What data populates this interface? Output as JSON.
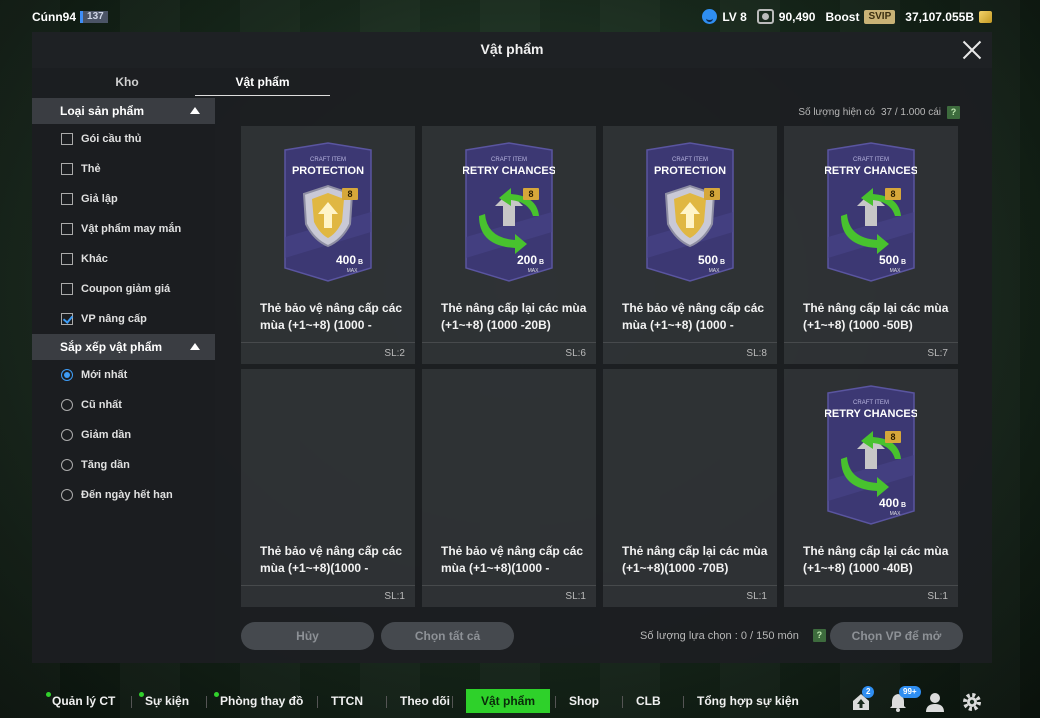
{
  "topbar": {
    "username": "Cúnn94",
    "user_level": "137",
    "lv": "LV 8",
    "coins": "90,490",
    "boost": "Boost",
    "svip": "SVIP",
    "b_amount": "37,107.055B"
  },
  "panel": {
    "title": "Vật phẩm",
    "tabs": [
      {
        "label": "Kho",
        "active": false
      },
      {
        "label": "Vật phẩm",
        "active": true
      }
    ]
  },
  "sidebar": {
    "product_type": {
      "title": "Loại sản phẩm",
      "options": [
        {
          "label": "Gói cầu thủ",
          "checked": false
        },
        {
          "label": "Thẻ",
          "checked": false
        },
        {
          "label": "Giả lập",
          "checked": false
        },
        {
          "label": "Vật phẩm may mắn",
          "checked": false
        },
        {
          "label": "Khác",
          "checked": false
        },
        {
          "label": "Coupon giảm giá",
          "checked": false
        },
        {
          "label": "VP nâng cấp",
          "checked": true
        }
      ]
    },
    "sort": {
      "title": "Sắp xếp vật phẩm",
      "options": [
        {
          "label": "Mới nhất",
          "selected": true
        },
        {
          "label": "Cũ nhất",
          "selected": false
        },
        {
          "label": "Giảm dần",
          "selected": false
        },
        {
          "label": "Tăng dần",
          "selected": false
        },
        {
          "label": "Đến ngày hết hạn",
          "selected": false
        }
      ]
    }
  },
  "content": {
    "count_label": "Số lượng hiện có",
    "count_value": "37 / 1.000 cái",
    "help": "?",
    "items": [
      {
        "art": "protection",
        "craft": "CRAFT ITEM",
        "art_title": "PROTECTION",
        "level": "8",
        "price": "400",
        "unit": "B",
        "max": "MAX",
        "name": "Thẻ bảo vệ nâng cấp các mùa (+1~+8) (1000 -",
        "sl": "SL:2"
      },
      {
        "art": "retry",
        "craft": "CRAFT ITEM",
        "art_title": "RETRY CHANCES",
        "level": "8",
        "price": "200",
        "unit": "B",
        "max": "MAX",
        "name": "Thẻ nâng cấp lại các mùa (+1~+8) (1000 -20B)",
        "sl": "SL:6"
      },
      {
        "art": "protection",
        "craft": "CRAFT ITEM",
        "art_title": "PROTECTION",
        "level": "8",
        "price": "500",
        "unit": "B",
        "max": "MAX",
        "name": "Thẻ bảo vệ nâng cấp các mùa (+1~+8) (1000 -",
        "sl": "SL:8"
      },
      {
        "art": "retry",
        "craft": "CRAFT ITEM",
        "art_title": "RETRY CHANCES",
        "level": "8",
        "price": "500",
        "unit": "B",
        "max": "MAX",
        "name": "Thẻ nâng cấp lại các mùa (+1~+8) (1000 -50B)",
        "sl": "SL:7"
      },
      {
        "art": "none",
        "name": "Thẻ bảo vệ nâng cấp các mùa (+1~+8)(1000 -",
        "sl": "SL:1"
      },
      {
        "art": "none",
        "name": "Thẻ bảo vệ nâng cấp các mùa (+1~+8)(1000 -",
        "sl": "SL:1"
      },
      {
        "art": "none",
        "name": "Thẻ nâng cấp lại các mùa (+1~+8)(1000 -70B)",
        "sl": "SL:1"
      },
      {
        "art": "retry",
        "craft": "CRAFT ITEM",
        "art_title": "RETRY CHANCES",
        "level": "8",
        "price": "400",
        "unit": "B",
        "max": "MAX",
        "name": "Thẻ nâng cấp lại các mùa (+1~+8) (1000 -40B)",
        "sl": "SL:1"
      }
    ]
  },
  "actions": {
    "cancel": "Hủy",
    "select_all": "Chọn tất cả",
    "selected_label": "Số lượng lựa chọn : 0 / 150 món",
    "help": "?",
    "open": "Chọn VP để mở"
  },
  "nav": {
    "items": [
      {
        "label": "Quản lý CT",
        "dot": true
      },
      {
        "label": "Sự kiện",
        "dot": true
      },
      {
        "label": "Phòng thay đồ",
        "dot": true
      },
      {
        "label": "TTCN",
        "dot": false
      },
      {
        "label": "Theo dõi",
        "dot": false
      },
      {
        "label": "Vật phẩm",
        "dot": false,
        "active": true
      },
      {
        "label": "Shop",
        "dot": false
      },
      {
        "label": "CLB",
        "dot": false
      },
      {
        "label": "Tổng hợp sự kiện",
        "dot": false
      }
    ],
    "icons": [
      {
        "name": "upload-icon",
        "badge": "2"
      },
      {
        "name": "bell-icon",
        "badge": "99+"
      },
      {
        "name": "profile-icon",
        "badge": ""
      },
      {
        "name": "gear-icon",
        "badge": ""
      }
    ]
  },
  "colors": {
    "accent_green": "#2ed12a",
    "accent_blue": "#3e9cf5",
    "card_purple": "#4a4486"
  }
}
